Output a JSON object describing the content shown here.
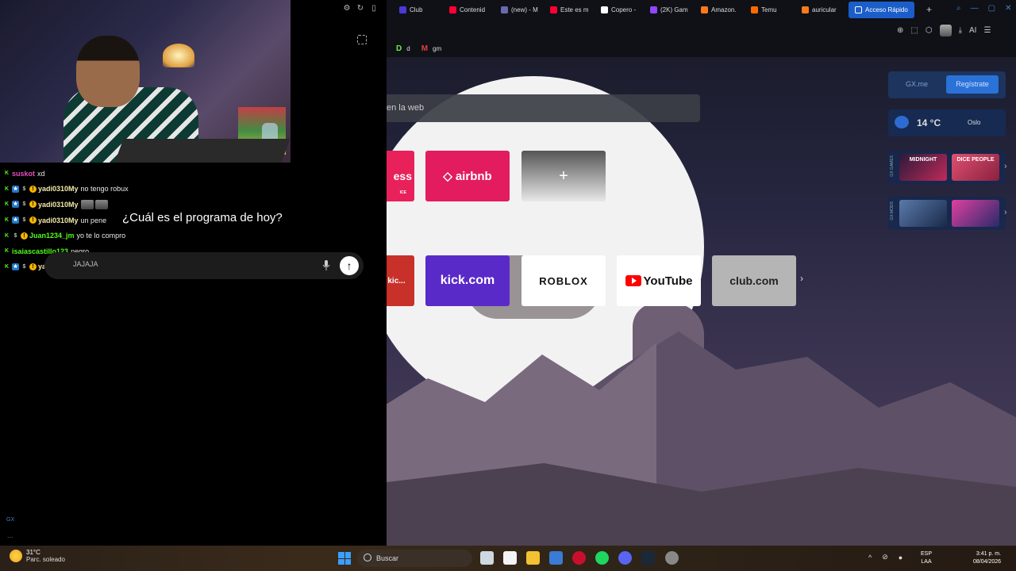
{
  "stream": {
    "caption": "¿Cuál es el programa de hoy?",
    "chat": [
      {
        "user": "suskot",
        "user_color": "#e84fbd",
        "message": "xd",
        "badges": [
          "kick"
        ]
      },
      {
        "user": "yadi0310My",
        "user_color": "#f5e9a8",
        "message": "no tengo robux",
        "badges": [
          "kick",
          "star",
          "sub",
          "excl"
        ]
      },
      {
        "user": "yadi0310My",
        "user_color": "#f5e9a8",
        "message": "",
        "badges": [
          "kick",
          "star",
          "sub",
          "excl"
        ],
        "emotes": 2
      },
      {
        "user": "yadi0310My",
        "user_color": "#f5e9a8",
        "message": "un pene",
        "badges": [
          "kick",
          "star",
          "sub",
          "excl"
        ]
      },
      {
        "user": "Juan1234_jm",
        "user_color": "#53fc18",
        "message": "yo te lo compro",
        "badges": [
          "kick",
          "sub",
          "excl"
        ]
      },
      {
        "user": "isaiascastillo123",
        "user_color": "#53fc18",
        "message": "negro",
        "badges": [
          "kick"
        ]
      },
      {
        "user": "yadi0310My",
        "user_color": "#f5e9a8",
        "message": "JAJAJA",
        "badges": [
          "kick",
          "star",
          "sub",
          "excl"
        ]
      }
    ],
    "assistant_input": "JAJAJA",
    "gx_mark": "GX",
    "dots": "..."
  },
  "browser": {
    "tabs": [
      {
        "label": "Club",
        "icon_color": "#4a3ad8"
      },
      {
        "label": "Contenid",
        "icon_color": "#ff0033"
      },
      {
        "label": "(new) - M",
        "icon_color": "#6a6aaa"
      },
      {
        "label": "Este es m",
        "icon_color": "#ff0033"
      },
      {
        "label": "Copero -",
        "icon_color": "#ffffff"
      },
      {
        "label": "(2K) Gam",
        "icon_color": "#9146ff"
      },
      {
        "label": "Amazon.",
        "icon_color": "#ff7a1a"
      },
      {
        "label": "Temu",
        "icon_color": "#ff6a00"
      },
      {
        "label": "auricular",
        "icon_color": "#ff7a1a"
      }
    ],
    "active_tab": "Acceso Rápido",
    "new_tab": "+",
    "bookmarks": [
      {
        "icon": "D",
        "label": "d"
      },
      {
        "icon": "M",
        "label": "gm"
      }
    ],
    "toolbar_ai": "AI",
    "search_placeholder": "en la web",
    "tiles": {
      "express": "ess",
      "express_sub": "ICE",
      "airbnb": "airbnb",
      "add": "+",
      "kic": "kic...",
      "kick": "kick.com",
      "roblox": "ROBLOX",
      "youtube": "YouTube",
      "club": "club.com"
    },
    "gx": {
      "me": "GX.me",
      "register": "Regístrate",
      "temp": "14 °C",
      "city": "Oslo",
      "games_label": "GX GAMES",
      "mods_label": "GX MODS",
      "game1": "MIDNIGHT",
      "game2": "DICE PEOPLE"
    }
  },
  "taskbar": {
    "temp": "31°C",
    "condition": "Parc. soleado",
    "search": "Buscar",
    "lang_1": "ESP",
    "lang_2": "LAA",
    "time": "3:41 p. m.",
    "date": "08/04/2026"
  }
}
